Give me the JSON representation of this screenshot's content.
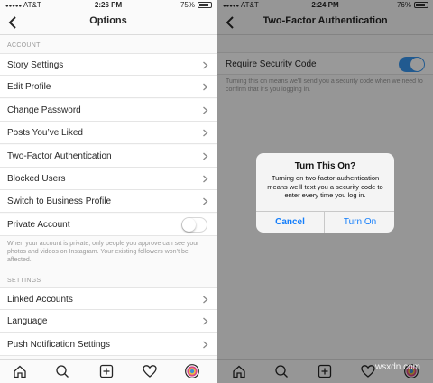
{
  "left": {
    "status": {
      "carrier": "AT&T",
      "time": "2:26 PM",
      "battery": "75%"
    },
    "nav": {
      "title": "Options"
    },
    "section_account": "ACCOUNT",
    "account_items": [
      {
        "label": "Story Settings"
      },
      {
        "label": "Edit Profile"
      },
      {
        "label": "Change Password"
      },
      {
        "label": "Posts You’ve Liked"
      },
      {
        "label": "Two-Factor Authentication"
      },
      {
        "label": "Blocked Users"
      },
      {
        "label": "Switch to Business Profile"
      }
    ],
    "private_account": {
      "label": "Private Account",
      "on": false
    },
    "private_help": "When your account is private, only people you approve can see your photos and videos on Instagram. Your existing followers won’t be affected.",
    "section_settings": "SETTINGS",
    "settings_items": [
      {
        "label": "Linked Accounts"
      },
      {
        "label": "Language"
      },
      {
        "label": "Push Notification Settings"
      }
    ],
    "tabs": [
      "home-icon",
      "search-icon",
      "add-icon",
      "heart-icon",
      "profile-icon"
    ]
  },
  "right": {
    "status": {
      "carrier": "AT&T",
      "time": "2:24 PM",
      "battery": "76%"
    },
    "nav": {
      "title": "Two-Factor Authentication"
    },
    "require_code": {
      "label": "Require Security Code",
      "on": true
    },
    "help": "Turning this on means we’ll send you a security code when we need to confirm that it’s you logging in.",
    "alert": {
      "title": "Turn This On?",
      "message": "Turning on two-factor authentication means we’ll text you a security code to enter every time you log in.",
      "cancel": "Cancel",
      "confirm": "Turn On"
    },
    "watermark": "wsxdn.com"
  },
  "colors": {
    "accent": "#3897f0",
    "ios_blue": "#147efb"
  }
}
